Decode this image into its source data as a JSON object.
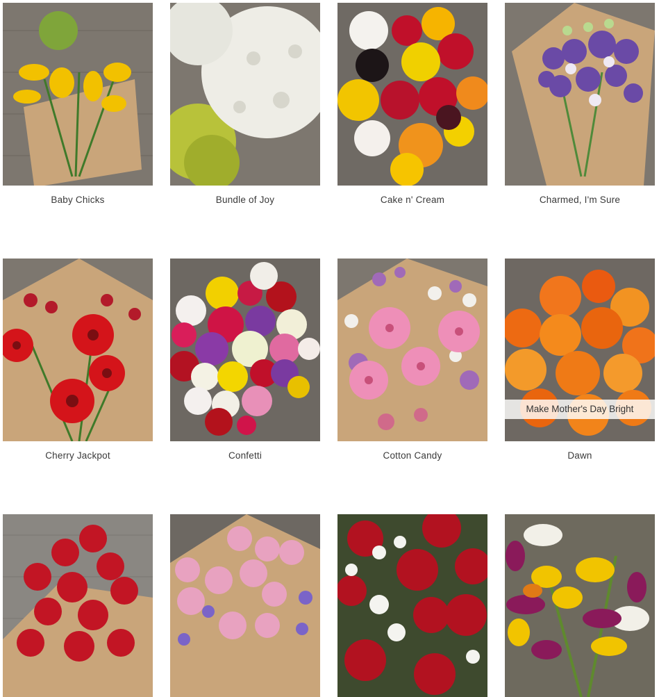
{
  "products": [
    {
      "name": "Baby Chicks",
      "image_alt": "Baby Chicks bouquet"
    },
    {
      "name": "Bundle of Joy",
      "image_alt": "Bundle of Joy bouquet"
    },
    {
      "name": "Cake n' Cream",
      "image_alt": "Cake n' Cream bouquet"
    },
    {
      "name": "Charmed, I'm Sure",
      "image_alt": "Charmed, I'm Sure bouquet"
    },
    {
      "name": "Cherry Jackpot",
      "image_alt": "Cherry Jackpot bouquet"
    },
    {
      "name": "Confetti",
      "image_alt": "Confetti bouquet"
    },
    {
      "name": "Cotton Candy",
      "image_alt": "Cotton Candy bouquet"
    },
    {
      "name": "Dawn",
      "image_alt": "Dawn bouquet",
      "hover_label": "Make Mother's Day Bright"
    },
    {
      "name": "",
      "image_alt": "Red roses bouquet"
    },
    {
      "name": "",
      "image_alt": "Pink roses bouquet"
    },
    {
      "name": "",
      "image_alt": "Red rose and white flower bouquet"
    },
    {
      "name": "",
      "image_alt": "Calla lily bouquet"
    }
  ],
  "colors": {
    "wood": "#7a746c",
    "kraft": "#c9a57a",
    "text": "#3a3a3a"
  }
}
